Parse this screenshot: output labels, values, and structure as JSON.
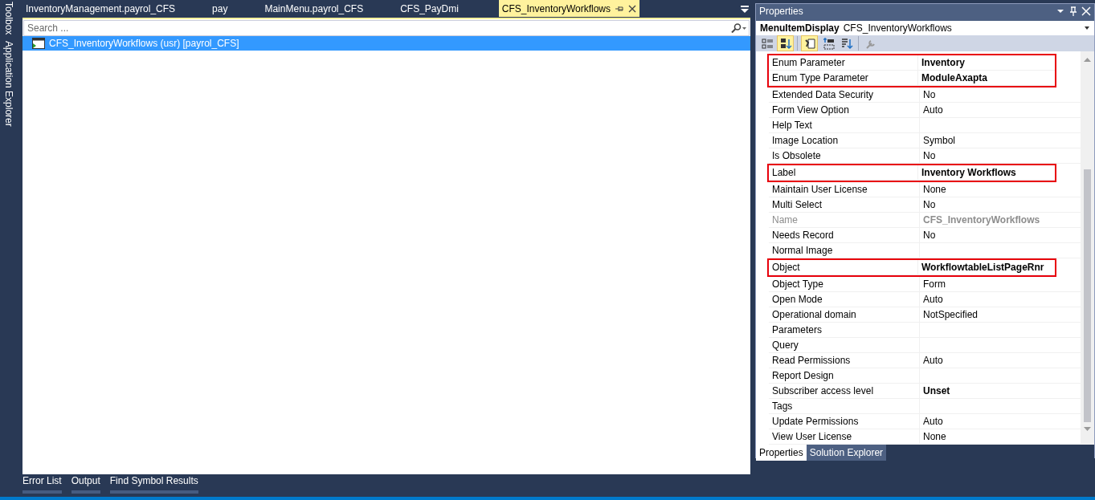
{
  "side_tabs": [
    {
      "label": "Toolbox"
    },
    {
      "label": "Application Explorer"
    }
  ],
  "doc_tabs": [
    {
      "label": "InventoryManagement.payrol_CFS",
      "selected": false
    },
    {
      "label": "pay",
      "selected": false
    },
    {
      "label": "MainMenu.payrol_CFS",
      "selected": false
    },
    {
      "label": "CFS_PayDmi",
      "selected": false
    },
    {
      "label": "CFS_InventoryWorkflows",
      "selected": true
    }
  ],
  "search": {
    "placeholder": "Search ..."
  },
  "tree": [
    {
      "label": "CFS_InventoryWorkflows (usr) [payrol_CFS]",
      "selected": true
    }
  ],
  "bottom_tabs": [
    "Error List",
    "Output",
    "Find Symbol Results"
  ],
  "properties": {
    "title": "Properties",
    "object_type": "MenuItemDisplay",
    "object_name": "CFS_InventoryWorkflows",
    "toolbar": [
      {
        "kind": "categorized",
        "selected": false
      },
      {
        "kind": "alphabetical",
        "selected": true
      },
      {
        "kind": "properties",
        "selected": true
      },
      {
        "kind": "events",
        "selected": false
      },
      {
        "kind": "sort",
        "selected": false
      },
      {
        "kind": "wrench",
        "selected": false
      }
    ],
    "rows": [
      {
        "name": "Enum Parameter",
        "value": "Inventory",
        "modified": true,
        "readonly": false,
        "highlighted": true
      },
      {
        "name": "Enum Type Parameter",
        "value": "ModuleAxapta",
        "modified": true,
        "readonly": false,
        "highlighted": true
      },
      {
        "name": "Extended Data Security",
        "value": "No",
        "modified": false,
        "readonly": false,
        "highlighted": false
      },
      {
        "name": "Form View Option",
        "value": "Auto",
        "modified": false,
        "readonly": false,
        "highlighted": false
      },
      {
        "name": "Help Text",
        "value": "",
        "readonly": false,
        "highlighted": false
      },
      {
        "name": "Image Location",
        "value": "Symbol",
        "modified": false,
        "readonly": false,
        "highlighted": false
      },
      {
        "name": "Is Obsolete",
        "value": "No",
        "modified": false,
        "readonly": false,
        "highlighted": false
      },
      {
        "name": "Label",
        "value": "Inventory Workflows",
        "modified": true,
        "readonly": false,
        "highlighted": true
      },
      {
        "name": "Maintain User License",
        "value": "None",
        "modified": false,
        "readonly": false,
        "highlighted": false
      },
      {
        "name": "Multi Select",
        "value": "No",
        "modified": false,
        "readonly": false,
        "highlighted": false
      },
      {
        "name": "Name",
        "value": "CFS_InventoryWorkflows",
        "modified": true,
        "readonly": true,
        "highlighted": false
      },
      {
        "name": "Needs Record",
        "value": "No",
        "modified": false,
        "readonly": false,
        "highlighted": false
      },
      {
        "name": "Normal Image",
        "value": "",
        "readonly": false,
        "highlighted": false
      },
      {
        "name": "Object",
        "value": "WorkflowtableListPageRnr",
        "modified": true,
        "readonly": false,
        "highlighted": true
      },
      {
        "name": "Object Type",
        "value": "Form",
        "modified": false,
        "readonly": false,
        "highlighted": false
      },
      {
        "name": "Open Mode",
        "value": "Auto",
        "modified": false,
        "readonly": false,
        "highlighted": false
      },
      {
        "name": "Operational domain",
        "value": "NotSpecified",
        "modified": false,
        "readonly": false,
        "highlighted": false
      },
      {
        "name": "Parameters",
        "value": "",
        "readonly": false,
        "highlighted": false
      },
      {
        "name": "Query",
        "value": "",
        "readonly": false,
        "highlighted": false
      },
      {
        "name": "Read Permissions",
        "value": "Auto",
        "modified": false,
        "readonly": false,
        "highlighted": false
      },
      {
        "name": "Report Design",
        "value": "",
        "readonly": false,
        "highlighted": false
      },
      {
        "name": "Subscriber access level",
        "value": "Unset",
        "modified": true,
        "readonly": false,
        "highlighted": false
      },
      {
        "name": "Tags",
        "value": "",
        "readonly": false,
        "highlighted": false
      },
      {
        "name": "Update Permissions",
        "value": "Auto",
        "modified": false,
        "readonly": false,
        "highlighted": false
      },
      {
        "name": "View User License",
        "value": "None",
        "modified": false,
        "readonly": false,
        "highlighted": false
      }
    ],
    "bottom_tabs": [
      {
        "label": "Properties",
        "selected": true
      },
      {
        "label": "Solution Explorer",
        "selected": false
      }
    ]
  }
}
